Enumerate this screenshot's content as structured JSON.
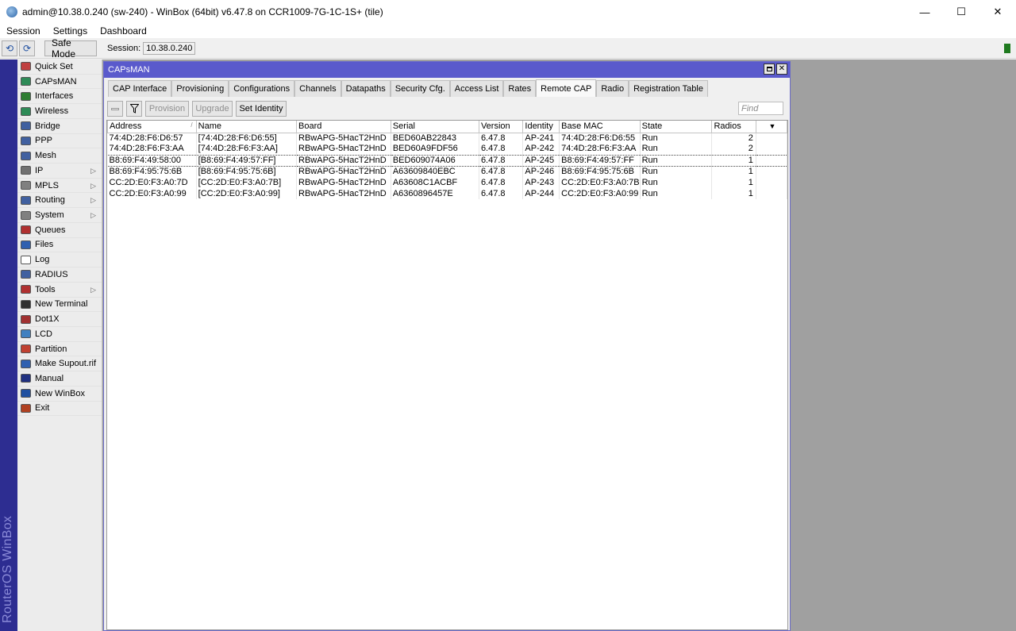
{
  "window": {
    "title": "admin@10.38.0.240 (sw-240) - WinBox (64bit) v6.47.8 on CCR1009-7G-1C-1S+ (tile)",
    "minimize": "—",
    "maximize": "☐",
    "close": "✕"
  },
  "menu": [
    "Session",
    "Settings",
    "Dashboard"
  ],
  "toolbar": {
    "undo": "⟲",
    "redo": "⟳",
    "safe_mode": "Safe Mode",
    "session_label": "Session:",
    "session_value": "10.38.0.240"
  },
  "brand": "RouterOS WinBox",
  "sidebar": [
    {
      "label": "Quick Set",
      "icon": "quick-set-icon",
      "color": "#c04040",
      "submenu": false
    },
    {
      "label": "CAPsMAN",
      "icon": "capsman-icon",
      "color": "#2e8b57",
      "submenu": false
    },
    {
      "label": "Interfaces",
      "icon": "interfaces-icon",
      "color": "#2e7d32",
      "submenu": false
    },
    {
      "label": "Wireless",
      "icon": "wireless-icon",
      "color": "#2e8b57",
      "submenu": false
    },
    {
      "label": "Bridge",
      "icon": "bridge-icon",
      "color": "#4060a0",
      "submenu": false
    },
    {
      "label": "PPP",
      "icon": "ppp-icon",
      "color": "#4060a0",
      "submenu": false
    },
    {
      "label": "Mesh",
      "icon": "mesh-icon",
      "color": "#4060a0",
      "submenu": false
    },
    {
      "label": "IP",
      "icon": "ip-icon",
      "color": "#707070",
      "submenu": true
    },
    {
      "label": "MPLS",
      "icon": "mpls-icon",
      "color": "#808080",
      "submenu": true
    },
    {
      "label": "Routing",
      "icon": "routing-icon",
      "color": "#4060a0",
      "submenu": true
    },
    {
      "label": "System",
      "icon": "system-icon",
      "color": "#808080",
      "submenu": true
    },
    {
      "label": "Queues",
      "icon": "queues-icon",
      "color": "#b03030",
      "submenu": false
    },
    {
      "label": "Files",
      "icon": "files-icon",
      "color": "#3060b0",
      "submenu": false
    },
    {
      "label": "Log",
      "icon": "log-icon",
      "color": "#ffffff",
      "submenu": false
    },
    {
      "label": "RADIUS",
      "icon": "radius-icon",
      "color": "#4060a0",
      "submenu": false
    },
    {
      "label": "Tools",
      "icon": "tools-icon",
      "color": "#b03030",
      "submenu": true
    },
    {
      "label": "New Terminal",
      "icon": "terminal-icon",
      "color": "#303030",
      "submenu": false
    },
    {
      "label": "Dot1X",
      "icon": "dot1x-icon",
      "color": "#a03030",
      "submenu": false
    },
    {
      "label": "LCD",
      "icon": "lcd-icon",
      "color": "#4080c0",
      "submenu": false
    },
    {
      "label": "Partition",
      "icon": "partition-icon",
      "color": "#c04030",
      "submenu": false
    },
    {
      "label": "Make Supout.rif",
      "icon": "supout-icon",
      "color": "#3060b0",
      "submenu": false
    },
    {
      "label": "Manual",
      "icon": "manual-icon",
      "color": "#203080",
      "submenu": false
    },
    {
      "label": "New WinBox",
      "icon": "winbox-icon",
      "color": "#2050a0",
      "submenu": false
    },
    {
      "label": "Exit",
      "icon": "exit-icon",
      "color": "#b04020",
      "submenu": false
    }
  ],
  "capsman": {
    "title": "CAPsMAN",
    "tabs": [
      "CAP Interface",
      "Provisioning",
      "Configurations",
      "Channels",
      "Datapaths",
      "Security Cfg.",
      "Access List",
      "Rates",
      "Remote CAP",
      "Radio",
      "Registration Table"
    ],
    "active_tab": "Remote CAP",
    "buttons": {
      "provision": "Provision",
      "upgrade": "Upgrade",
      "set_identity": "Set Identity",
      "find_placeholder": "Find"
    },
    "columns": [
      "Address",
      "Name",
      "Board",
      "Serial",
      "Version",
      "Identity",
      "Base MAC",
      "State",
      "Radios"
    ],
    "rows": [
      [
        "74:4D:28:F6:D6:57",
        "[74:4D:28:F6:D6:55]",
        "RBwAPG-5HacT2HnD",
        "BED60AB22843",
        "6.47.8",
        "AP-241",
        "74:4D:28:F6:D6:55",
        "Run",
        "2"
      ],
      [
        "74:4D:28:F6:F3:AA",
        "[74:4D:28:F6:F3:AA]",
        "RBwAPG-5HacT2HnD",
        "BED60A9FDF56",
        "6.47.8",
        "AP-242",
        "74:4D:28:F6:F3:AA",
        "Run",
        "2"
      ],
      [
        "B8:69:F4:49:58:00",
        "[B8:69:F4:49:57:FF]",
        "RBwAPG-5HacT2HnD",
        "BED609074A06",
        "6.47.8",
        "AP-245",
        "B8:69:F4:49:57:FF",
        "Run",
        "1"
      ],
      [
        "B8:69:F4:95:75:6B",
        "[B8:69:F4:95:75:6B]",
        "RBwAPG-5HacT2HnD",
        "A63609840EBC",
        "6.47.8",
        "AP-246",
        "B8:69:F4:95:75:6B",
        "Run",
        "1"
      ],
      [
        "CC:2D:E0:F3:A0:7D",
        "[CC:2D:E0:F3:A0:7B]",
        "RBwAPG-5HacT2HnD",
        "A63608C1ACBF",
        "6.47.8",
        "AP-243",
        "CC:2D:E0:F3:A0:7B",
        "Run",
        "1"
      ],
      [
        "CC:2D:E0:F3:A0:99",
        "[CC:2D:E0:F3:A0:99]",
        "RBwAPG-5HacT2HnD",
        "A6360896457E",
        "6.47.8",
        "AP-244",
        "CC:2D:E0:F3:A0:99",
        "Run",
        "1"
      ]
    ],
    "selected_row": 2
  }
}
